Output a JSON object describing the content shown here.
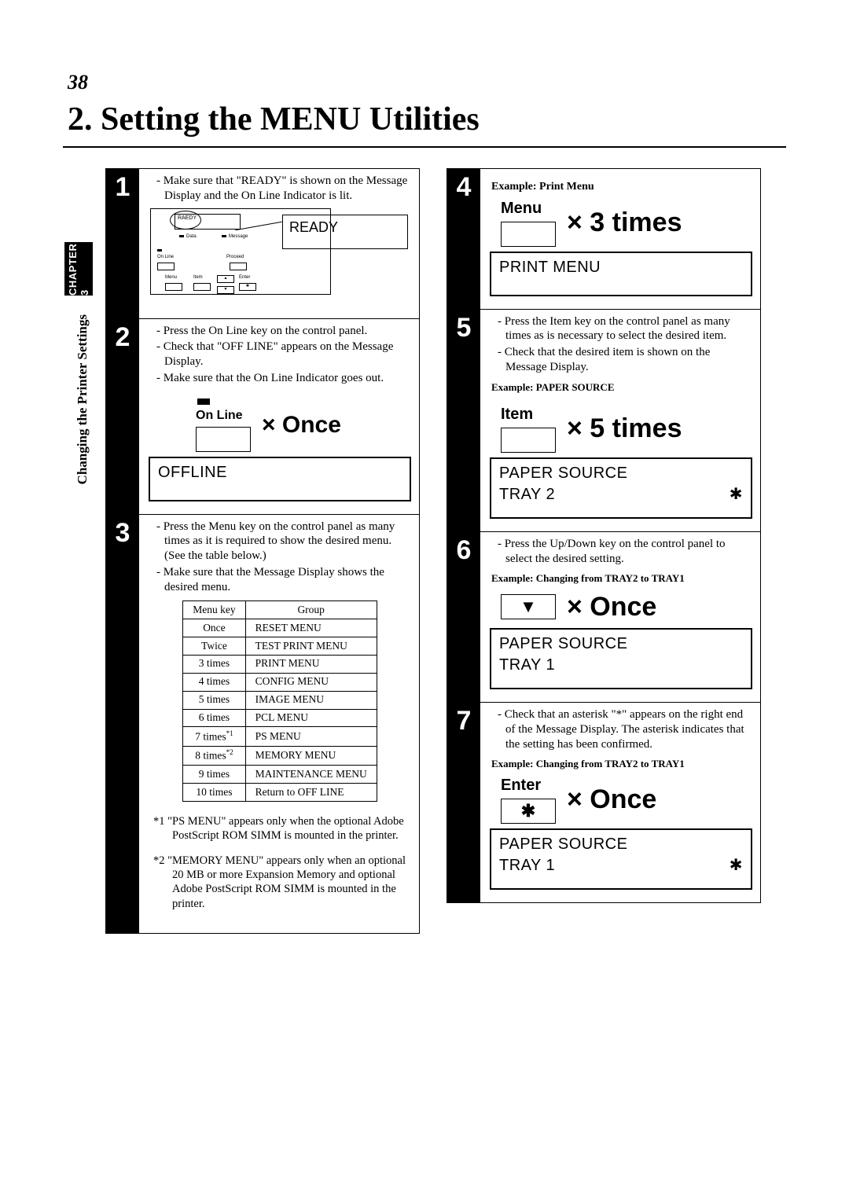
{
  "page_number": "38",
  "chapter_title": "2. Setting the MENU Utilities",
  "side_tab": "CHAPTER 3",
  "side_label": "Changing the Printer Settings",
  "step1": {
    "num": "1",
    "b1": "Make sure that \"READY\" is shown on the Message Display and the On Line Indicator is lit.",
    "panel_disp": "RAEDY",
    "callout_lcd": "READY"
  },
  "step2": {
    "num": "2",
    "b1": "Press the On Line key on the control panel.",
    "b2": "Check that \"OFF LINE\" appears on the Message Display.",
    "b3": "Make sure that the On Line Indicator goes out.",
    "key_label": "On Line",
    "times": "× Once",
    "lcd1": "OFFLINE"
  },
  "step3": {
    "num": "3",
    "b1": "Press the Menu key on the control panel as many times as it is required to show the desired menu. (See the table below.)",
    "b2": "Make sure that the Message Display shows the desired menu.",
    "th1": "Menu key",
    "th2": "Group",
    "rows": [
      {
        "k": "Once",
        "g": "RESET MENU"
      },
      {
        "k": "Twice",
        "g": "TEST PRINT MENU"
      },
      {
        "k": "3 times",
        "g": "PRINT MENU"
      },
      {
        "k": "4 times",
        "g": "CONFIG MENU"
      },
      {
        "k": "5 times",
        "g": "IMAGE MENU"
      },
      {
        "k": "6 times",
        "g": "PCL MENU"
      },
      {
        "k": "7 times*1",
        "g": "PS MENU"
      },
      {
        "k": "8 times*2",
        "g": "MEMORY MENU"
      },
      {
        "k": "9 times",
        "g": "MAINTENANCE MENU"
      },
      {
        "k": "10 times",
        "g": "Return to OFF LINE"
      }
    ],
    "fn1_mark": "*1",
    "fn1": "\"PS MENU\" appears only when the optional Adobe PostScript ROM SIMM is mounted in the printer.",
    "fn2_mark": "*2",
    "fn2": "\"MEMORY MENU\" appears only when an optional 20 MB or more Expansion Memory and optional Adobe PostScript ROM SIMM is mounted in the printer."
  },
  "step4": {
    "num": "4",
    "ex_label": "Example: Print Menu",
    "key_label": "Menu",
    "times": "× 3 times",
    "lcd1": "PRINT MENU"
  },
  "step5": {
    "num": "5",
    "b1": "Press the Item key on the control panel as many times as is necessary to select the desired item.",
    "b2": "Check that the desired item is shown on the Message Display.",
    "ex_label": "Example: PAPER SOURCE",
    "key_label": "Item",
    "times": "× 5 times",
    "lcd1": "PAPER SOURCE",
    "lcd2": "TRAY 2",
    "star": "✱"
  },
  "step6": {
    "num": "6",
    "b1": "Press the Up/Down key on the control panel to select the desired setting.",
    "ex_label": "Example: Changing from TRAY2 to TRAY1",
    "key_sym": "▼",
    "times": "× Once",
    "lcd1": "PAPER SOURCE",
    "lcd2": "TRAY 1"
  },
  "step7": {
    "num": "7",
    "b1": "Check that an asterisk \"*\" appears on the right end of the Message Display.  The asterisk indicates that the setting has been confirmed.",
    "ex_label": "Example: Changing from TRAY2 to TRAY1",
    "key_label": "Enter",
    "key_sym": "✱",
    "times": "× Once",
    "lcd1": "PAPER SOURCE",
    "lcd2": "TRAY 1",
    "star": "✱"
  }
}
